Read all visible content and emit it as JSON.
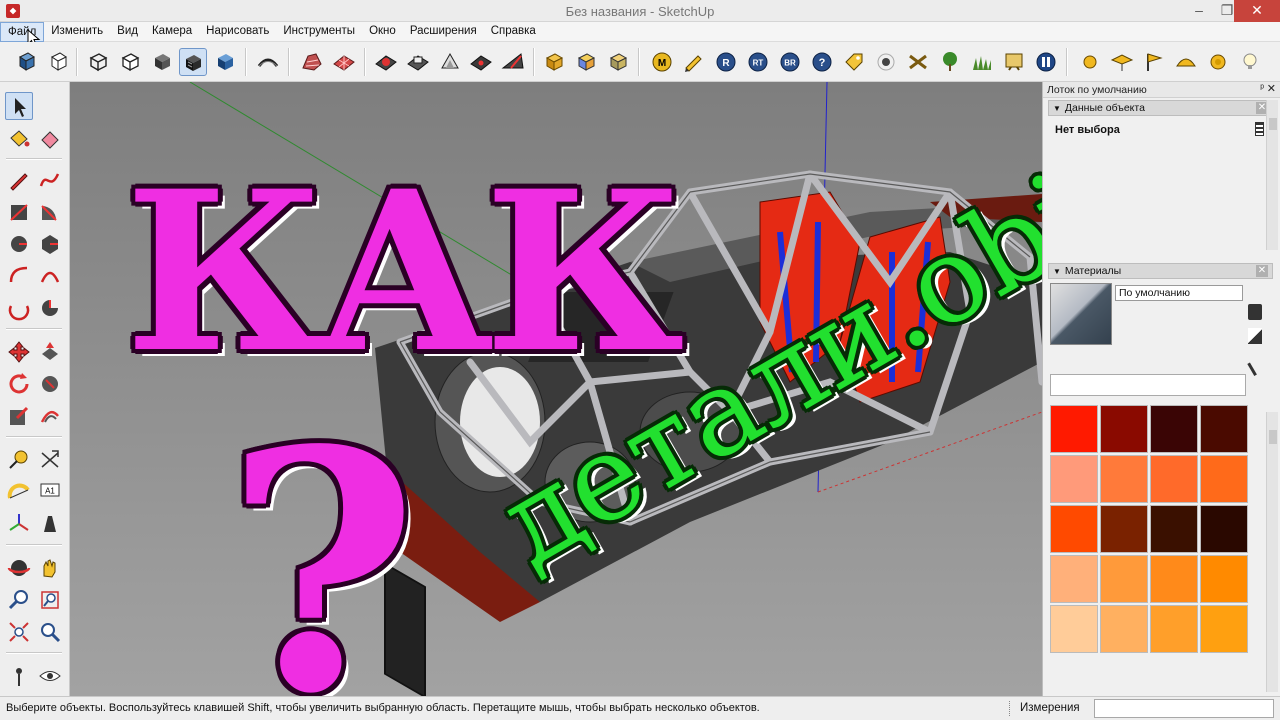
{
  "window": {
    "title": "Без названия - SketchUp",
    "minimize_glyph": "–",
    "restore_glyph": "❐",
    "close_glyph": "✕"
  },
  "menu": [
    "Файл",
    "Изменить",
    "Вид",
    "Камера",
    "Нарисовать",
    "Инструменты",
    "Окно",
    "Расширения",
    "Справка"
  ],
  "toolbar_icons": [
    "iso-view-icon",
    "box-view-icon",
    "wireframe-style-icon",
    "hidden-line-style-icon",
    "shaded-style-icon",
    "shaded-textures-style-icon",
    "monochrome-style-icon",
    "follow-me-icon",
    "sandbox-from-contours-icon",
    "sandbox-from-scratch-icon",
    "smoove-icon",
    "stamp-icon",
    "drape-icon",
    "add-detail-icon",
    "flip-edge-icon",
    "solid-outer-shell-icon",
    "solid-intersect-icon",
    "solid-union-icon",
    "plugin-m-icon",
    "plugin-pencil-icon",
    "plugin-r-icon",
    "plugin-rt-icon",
    "plugin-br-icon",
    "help-icon",
    "tag-icon",
    "dot-icon",
    "crossed-icon",
    "tree-icon",
    "grass-icon",
    "board-icon",
    "pause-icon",
    "sun-icon",
    "hat-icon",
    "flag-icon",
    "cap-icon",
    "coin-icon",
    "bulb-icon"
  ],
  "overlay": {
    "kak": "КАК",
    "question": "?",
    "obj": "детали.obj"
  },
  "tray": {
    "title": "Лоток по умолчанию",
    "entity_panel": "Данные объекта",
    "no_selection": "Нет выбора",
    "materials_panel": "Материалы",
    "material_name": "По умолчанию",
    "swatches": [
      "#ff1a00",
      "#8a0a00",
      "#3a0505",
      "#4a0a00",
      "#ff9a7a",
      "#ff7a3a",
      "#ff6a2a",
      "#ff6a1a",
      "#ff4a00",
      "#7a2200",
      "#3a1000",
      "#2a0800",
      "#ffb07a",
      "#ff9a3a",
      "#ff8a1a",
      "#ff8a00",
      "#ffcc99",
      "#ffb060",
      "#ff9f2a",
      "#ffa010"
    ]
  },
  "status": {
    "hint": "Выберите объекты. Воспользуйтесь клавишей Shift, чтобы увеличить выбранную область. Перетащите мышь, чтобы выбрать несколько объектов.",
    "measure_label": "Измерения",
    "measure_value": ""
  },
  "colors": {
    "overlay_magenta": "#ef2ee2",
    "overlay_green": "#22e02f",
    "seat_red": "#e52a14",
    "harness_blue": "#1c2ed8",
    "tube_gray": "#b9b9bd"
  }
}
